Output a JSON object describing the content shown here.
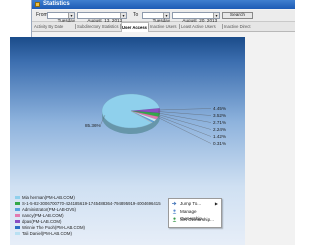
{
  "window": {
    "title": "Statistics"
  },
  "filter": {
    "from_label": "From",
    "from_day": "Tuesday",
    "from_date": "August  13, 2013",
    "to_label": "To",
    "to_day": "Tuesday",
    "to_date": "August  20, 2013",
    "search_label": "Search"
  },
  "tabs": [
    {
      "label": "Activity By Date"
    },
    {
      "label": "Subdirectory Statistics"
    },
    {
      "label": "User Access"
    },
    {
      "label": "Inactive Users"
    },
    {
      "label": "Least Active Users"
    },
    {
      "label": "Inactive Direct"
    }
  ],
  "chart_data": {
    "type": "pie",
    "slice_labels": [
      "85.36%",
      "4.45%",
      "3.52%",
      "2.71%",
      "2.24%",
      "1.42%",
      "0.31%"
    ],
    "values": [
      85.36,
      4.45,
      3.52,
      2.71,
      2.24,
      1.42,
      0.31
    ],
    "colors": [
      "#8fd0ec",
      "#8a4fc4",
      "#33a84a",
      "#e27ab0",
      "#c8e6f4",
      "#5aa3df",
      "#e0e0e0"
    ],
    "legend": [
      {
        "label": "Mia herman(PM-LAB.COM)",
        "color": "#8fd0ec"
      },
      {
        "label": "S-1-5-82-3006700770-424185619-1745488364-794895919-4004696415",
        "color": "#33a84a"
      },
      {
        "label": "Administrator(PM-LAB-DV5)",
        "color": "#5aa3df"
      },
      {
        "label": "nancy(PM-LAB.COM)",
        "color": "#e27ab0"
      },
      {
        "label": "dpas(PM-LAB.COM)",
        "color": "#8a4fc4"
      },
      {
        "label": "Winnie The Pooh(PM-LAB.COM)",
        "color": "#2c70c4"
      },
      {
        "label": "Tali Daniel(PM-LAB.COM)",
        "color": "#b9e0f2"
      }
    ]
  },
  "context_menu": {
    "items": [
      {
        "label": "Jump To...",
        "icon": "jump-icon",
        "has_submenu": true,
        "submenu_arrow": "▶"
      },
      {
        "label": "Manage Ownership...",
        "icon": "ownership-icon",
        "has_submenu": false
      },
      {
        "label": "Set Ownership...",
        "icon": "set-ownership-icon",
        "has_submenu": false
      }
    ]
  }
}
